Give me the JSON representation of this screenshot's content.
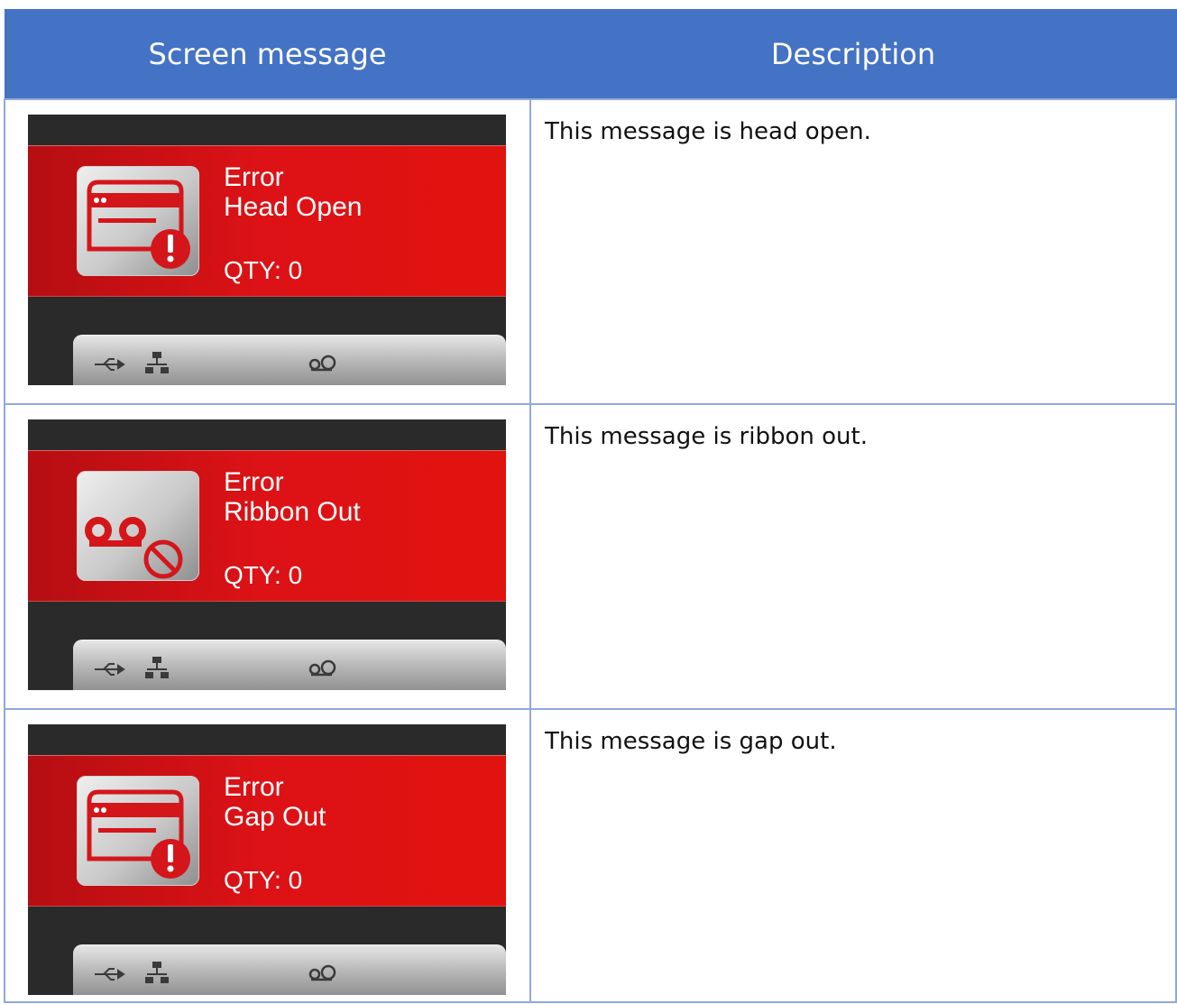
{
  "header": {
    "col1": "Screen message",
    "col2": "Description"
  },
  "rows": [
    {
      "title": "Error",
      "subtitle": "Head Open",
      "qty": "QTY: 0",
      "icon": "printhead-error-icon",
      "description": "This message is head open."
    },
    {
      "title": "Error",
      "subtitle": "Ribbon Out",
      "qty": "QTY: 0",
      "icon": "ribbon-out-icon",
      "description": "This message is ribbon out."
    },
    {
      "title": "Error",
      "subtitle": "Gap Out",
      "qty": "QTY: 0",
      "icon": "printhead-error-icon",
      "description": "This message is gap out."
    }
  ],
  "colors": {
    "header_bg": "#4472c4",
    "border": "#8ea9db",
    "error_red": "#dd1216"
  }
}
